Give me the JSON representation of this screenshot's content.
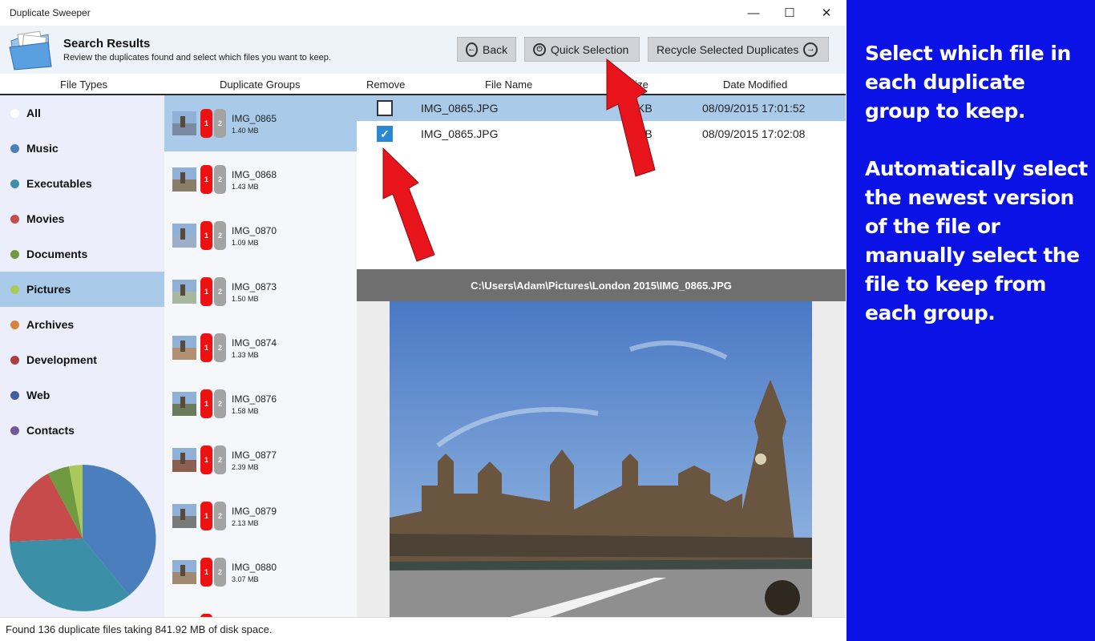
{
  "window": {
    "title": "Duplicate Sweeper",
    "minimize": "—",
    "maximize": "☐",
    "close": "✕"
  },
  "header": {
    "title": "Search Results",
    "subtitle": "Review the duplicates found and select which files you want to keep.",
    "back_label": "Back",
    "quick_selection_label": "Quick Selection",
    "recycle_label": "Recycle Selected Duplicates"
  },
  "columns": {
    "file_types": "File Types",
    "duplicate_groups": "Duplicate Groups",
    "remove": "Remove",
    "file_name": "File Name",
    "file_size": "File Size",
    "date_modified": "Date Modified"
  },
  "categories": [
    {
      "label": "All",
      "color": "#ffffff"
    },
    {
      "label": "Music",
      "color": "#4a7ebd"
    },
    {
      "label": "Executables",
      "color": "#3b8fa6"
    },
    {
      "label": "Movies",
      "color": "#c84b4b"
    },
    {
      "label": "Documents",
      "color": "#6f9a3f"
    },
    {
      "label": "Pictures",
      "color": "#a9c95a"
    },
    {
      "label": "Archives",
      "color": "#d9823b"
    },
    {
      "label": "Development",
      "color": "#b03d3d"
    },
    {
      "label": "Web",
      "color": "#3f5f9e"
    },
    {
      "label": "Contacts",
      "color": "#6e5a9c"
    }
  ],
  "selected_category": "Pictures",
  "groups": [
    {
      "name": "IMG_0865",
      "size": "1.40 MB",
      "badge1": "1",
      "badge2": "2"
    },
    {
      "name": "IMG_0868",
      "size": "1.43 MB",
      "badge1": "1",
      "badge2": "2"
    },
    {
      "name": "IMG_0870",
      "size": "1.09 MB",
      "badge1": "1",
      "badge2": "2"
    },
    {
      "name": "IMG_0873",
      "size": "1.50 MB",
      "badge1": "1",
      "badge2": "2"
    },
    {
      "name": "IMG_0874",
      "size": "1.33 MB",
      "badge1": "1",
      "badge2": "2"
    },
    {
      "name": "IMG_0876",
      "size": "1.58 MB",
      "badge1": "1",
      "badge2": "2"
    },
    {
      "name": "IMG_0877",
      "size": "2.39 MB",
      "badge1": "1",
      "badge2": "2"
    },
    {
      "name": "IMG_0879",
      "size": "2.13 MB",
      "badge1": "1",
      "badge2": "2"
    },
    {
      "name": "IMG_0880",
      "size": "3.07 MB",
      "badge1": "1",
      "badge2": "2"
    }
  ],
  "files": [
    {
      "checked": false,
      "name": "IMG_0865.JPG",
      "size": "KB",
      "date": "08/09/2015 17:01:52"
    },
    {
      "checked": true,
      "name": "IMG_0865.JPG",
      "size": "KB",
      "date": "08/09/2015 17:02:08"
    }
  ],
  "preview_path": "C:\\Users\\Adam\\Pictures\\London 2015\\IMG_0865.JPG",
  "status": "Found 136 duplicate files taking 841.92 MB of disk space.",
  "promo": {
    "line1": "Select which file in each duplicate group to keep.",
    "line2": "Automatically select the newest version of the file or manually select the file to keep from each group."
  },
  "colors": {
    "selection": "#a9cbe9",
    "promo_bg": "#0a12e6",
    "badge_red": "#ee1111",
    "arrow_red": "#e8141c",
    "checkbox_blue": "#2a87d4"
  }
}
